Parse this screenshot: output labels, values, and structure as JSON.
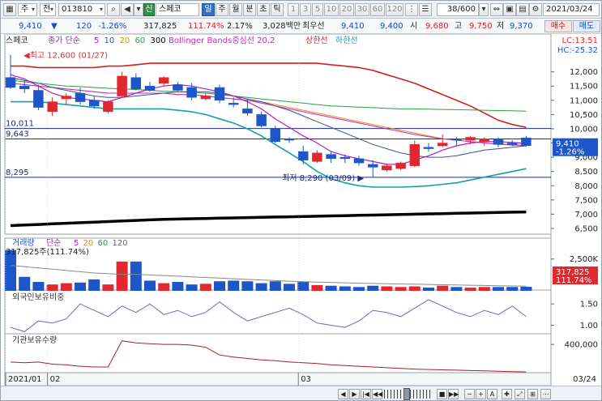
{
  "toolbar": {
    "market": "주",
    "market_type": "전",
    "stock_code": "013810",
    "badge_new": "신",
    "stock_name": "스페코",
    "periods": [
      "일",
      "주",
      "월",
      "분",
      "초",
      "틱"
    ],
    "active_period": "일",
    "intervals": [
      "1",
      "3",
      "5",
      "10",
      "20",
      "30",
      "60",
      "120"
    ],
    "count": "38/600",
    "date": "2021/03/24"
  },
  "quote": {
    "price": "9,410",
    "change": "120",
    "change_pct": "-1.26%",
    "volume": "317,825",
    "vol_ratio": "111.74%",
    "turnover": "2.17%",
    "amount": "3,028백만",
    "pref_label": "최우선",
    "bid1": "9,410",
    "ask1": "9,400",
    "open_label": "시",
    "open": "9,680",
    "high_label": "고",
    "high": "9,750",
    "low_label": "저",
    "low": "9,370",
    "buy_label": "매수",
    "sell_label": "매도"
  },
  "colors": {
    "up": "#e0282e",
    "down": "#1d56c8",
    "ma5": "#b01cc8",
    "ma10": "#3a4f9c",
    "ma20": "#e08a1e",
    "ma60": "#2e9e3e",
    "ma300": "#000000",
    "bb_mid": "#bf2bc3",
    "bb_upper": "#d11f1f",
    "bb_lower": "#14a0a8",
    "foreign": "#7a63c2",
    "inst": "#a81e2a"
  },
  "chart_data": [
    {
      "type": "candlestick",
      "panel": "price",
      "title_name": "스페코",
      "legend": {
        "close_label": "종가 단순",
        "ma_periods": [
          "5",
          "10",
          "20",
          "60",
          "300"
        ],
        "bb_label": "Bollinger Bands중심선 20,2",
        "bb_upper_label": "상한선",
        "bb_lower_label": "하한선"
      },
      "corner_lc": "LC:13.51",
      "corner_hc": "HC:-25.32",
      "ylim": [
        6300,
        13100
      ],
      "y_ticks": [
        12000,
        11500,
        11000,
        10500,
        10000,
        9500,
        9000,
        8500,
        8000,
        7500,
        7000,
        6500
      ],
      "y_tick_labels": [
        "12,000",
        "11,500",
        "11,000",
        "10,500",
        "10,000",
        "9,500",
        "9,000",
        "8,500",
        "8,000",
        "7,500",
        "7,000",
        "6,500"
      ],
      "ref_lines": [
        {
          "value": 10011,
          "label": "10,011"
        },
        {
          "value": 9643,
          "label": "9,643"
        },
        {
          "value": 8295,
          "label": "8,295"
        }
      ],
      "high_annot": {
        "value": 12600,
        "index": 0,
        "label": "최고 12,600 (01/27)"
      },
      "low_annot": {
        "value": 8290,
        "index": 26,
        "label": "최저 8,290 (03/09)"
      },
      "last_price_label": "9,410",
      "last_pct_label": "-1.26%",
      "ohlc": [
        [
          11800,
          12600,
          11400,
          11450
        ],
        [
          11500,
          11700,
          11250,
          11400
        ],
        [
          11350,
          11550,
          10650,
          10750
        ],
        [
          10600,
          11100,
          10450,
          10950
        ],
        [
          11050,
          11250,
          10850,
          11150
        ],
        [
          11250,
          11450,
          10850,
          10950
        ],
        [
          11000,
          11150,
          10700,
          10800
        ],
        [
          10600,
          11000,
          10550,
          10950
        ],
        [
          11150,
          12000,
          11100,
          11850
        ],
        [
          11800,
          11950,
          11350,
          11400
        ],
        [
          11500,
          11650,
          11300,
          11350
        ],
        [
          11600,
          11850,
          11500,
          11800
        ],
        [
          11550,
          11650,
          11300,
          11350
        ],
        [
          11450,
          11600,
          11000,
          11100
        ],
        [
          11050,
          11250,
          11000,
          11150
        ],
        [
          11450,
          11550,
          10900,
          11000
        ],
        [
          10900,
          11100,
          10750,
          10850
        ],
        [
          10700,
          11050,
          10450,
          10550
        ],
        [
          10500,
          10600,
          10050,
          10100
        ],
        [
          10000,
          10100,
          9500,
          9550
        ],
        [
          9650,
          9700,
          9500,
          9600
        ],
        [
          9200,
          9400,
          8750,
          8900
        ],
        [
          8850,
          9250,
          8800,
          9150
        ],
        [
          9100,
          9200,
          8800,
          8950
        ],
        [
          9000,
          9100,
          8800,
          8950
        ],
        [
          8950,
          9050,
          8700,
          8800
        ],
        [
          8750,
          8900,
          8290,
          8650
        ],
        [
          8550,
          8750,
          8500,
          8700
        ],
        [
          8600,
          8850,
          8550,
          8800
        ],
        [
          8700,
          9600,
          8650,
          9450
        ],
        [
          9350,
          9500,
          9200,
          9300
        ],
        [
          9400,
          9800,
          9350,
          9500
        ],
        [
          9650,
          9700,
          9400,
          9600
        ],
        [
          9600,
          9750,
          9450,
          9700
        ],
        [
          9550,
          9700,
          9400,
          9650
        ],
        [
          9650,
          9700,
          9350,
          9450
        ],
        [
          9500,
          9600,
          9400,
          9450
        ],
        [
          9680,
          9750,
          9370,
          9410
        ]
      ],
      "ma5": [
        11900,
        11750,
        11500,
        11250,
        11100,
        11050,
        11000,
        10950,
        11100,
        11250,
        11400,
        11500,
        11550,
        11500,
        11400,
        11300,
        11150,
        10950,
        10700,
        10350,
        10050,
        9750,
        9500,
        9200,
        9050,
        8950,
        8850,
        8750,
        8750,
        8900,
        9050,
        9250,
        9400,
        9500,
        9550,
        9550,
        9520,
        9480
      ],
      "ma10": [
        11800,
        11700,
        11600,
        11450,
        11350,
        11250,
        11150,
        11100,
        11100,
        11150,
        11200,
        11250,
        11300,
        11300,
        11300,
        11250,
        11150,
        11050,
        10950,
        10800,
        10650,
        10450,
        10250,
        10050,
        9850,
        9650,
        9450,
        9300,
        9150,
        9050,
        9000,
        9000,
        9050,
        9150,
        9250,
        9300,
        9350,
        9400
      ],
      "ma20": [
        11600,
        11550,
        11500,
        11450,
        11400,
        11350,
        11300,
        11250,
        11250,
        11250,
        11250,
        11250,
        11200,
        11200,
        11150,
        11100,
        11050,
        11000,
        10950,
        10850,
        10750,
        10650,
        10550,
        10450,
        10350,
        10250,
        10150,
        10050,
        9950,
        9850,
        9750,
        9650,
        9600,
        9550,
        9500,
        9450,
        9420,
        9400
      ],
      "ma60": [
        11700,
        11650,
        11600,
        11550,
        11500,
        11480,
        11450,
        11420,
        11400,
        11380,
        11350,
        11320,
        11300,
        11280,
        11250,
        11200,
        11150,
        11100,
        11050,
        11000,
        10950,
        10900,
        10850,
        10800,
        10780,
        10760,
        10740,
        10720,
        10700,
        10700,
        10690,
        10680,
        10670,
        10660,
        10650,
        10640,
        10630,
        10620
      ],
      "ma300": [
        6600,
        6620,
        6640,
        6660,
        6680,
        6700,
        6720,
        6740,
        6760,
        6780,
        6800,
        6820,
        6830,
        6840,
        6850,
        6860,
        6870,
        6880,
        6890,
        6900,
        6910,
        6920,
        6930,
        6940,
        6950,
        6960,
        6970,
        6980,
        6990,
        7000,
        7010,
        7020,
        7030,
        7040,
        7050,
        7060,
        7070,
        7080
      ],
      "bb_mid": [
        11600,
        11550,
        11500,
        11450,
        11400,
        11350,
        11300,
        11250,
        11250,
        11250,
        11250,
        11250,
        11200,
        11200,
        11150,
        11100,
        11050,
        11000,
        10900,
        10800,
        10700,
        10600,
        10500,
        10400,
        10300,
        10200,
        10100,
        10000,
        9900,
        9800,
        9720,
        9650,
        9600,
        9550,
        9500,
        9470,
        9440,
        9410
      ],
      "bb_upper": [
        12200,
        12200,
        12150,
        12150,
        12150,
        12150,
        12150,
        12200,
        12200,
        12250,
        12300,
        12300,
        12300,
        12300,
        12300,
        12300,
        12300,
        12300,
        12300,
        12300,
        12300,
        12300,
        12300,
        12250,
        12200,
        12150,
        12050,
        11900,
        11750,
        11600,
        11400,
        11200,
        11000,
        10800,
        10550,
        10300,
        10150,
        10050
      ],
      "bb_lower": [
        10950,
        10950,
        10950,
        10900,
        10850,
        10800,
        10750,
        10700,
        10700,
        10700,
        10700,
        10700,
        10650,
        10600,
        10500,
        10350,
        10200,
        10000,
        9750,
        9450,
        9150,
        8850,
        8500,
        8250,
        8100,
        8000,
        7950,
        7950,
        7950,
        7970,
        8000,
        8050,
        8100,
        8200,
        8300,
        8400,
        8500,
        8600
      ]
    },
    {
      "type": "bar",
      "panel": "volume",
      "title_name": "거래량",
      "legend_label": "단순",
      "ma_periods": [
        "5",
        "20",
        "60",
        "120"
      ],
      "top_label": "317,825주(111.74%)",
      "right_value": "317,825",
      "right_pct": "111.74%",
      "y_tick_label": "2,500K",
      "ylim": [
        0,
        3500000
      ],
      "values": [
        3200000,
        1100000,
        700000,
        500000,
        600000,
        650000,
        900000,
        500000,
        2300000,
        2300000,
        800000,
        600000,
        700000,
        500000,
        550000,
        750000,
        800000,
        750000,
        600000,
        750000,
        550000,
        700000,
        450000,
        400000,
        350000,
        300000,
        400000,
        350000,
        300000,
        350000,
        250000,
        400000,
        300000,
        250000,
        300000,
        300000,
        300000,
        320000
      ],
      "ma": [
        2000000,
        1900000,
        1800000,
        1700000,
        1600000,
        1500000,
        1400000,
        1350000,
        1300000,
        1300000,
        1250000,
        1200000,
        1150000,
        1100000,
        1050000,
        1000000,
        950000,
        900000,
        850000,
        800000,
        760000,
        720000,
        690000,
        660000,
        630000,
        600000,
        580000,
        560000,
        540000,
        520000,
        500000,
        480000,
        460000,
        440000,
        420000,
        400000,
        380000,
        360000
      ]
    },
    {
      "type": "line",
      "panel": "foreign",
      "title_name": "외국인보유비중",
      "y_ticks": [
        1.5,
        1.0
      ],
      "y_tick_labels": [
        "1.50",
        "1.00"
      ],
      "ylim": [
        0.8,
        1.75
      ],
      "values": [
        0.95,
        0.85,
        1.1,
        1.05,
        1.15,
        1.5,
        1.35,
        1.2,
        1.45,
        1.3,
        1.5,
        1.25,
        1.35,
        1.2,
        1.3,
        1.55,
        1.3,
        1.1,
        1.2,
        1.3,
        1.4,
        1.25,
        1.05,
        1.0,
        0.95,
        1.1,
        1.35,
        1.3,
        1.2,
        1.4,
        1.6,
        1.45,
        1.3,
        1.2,
        1.35,
        1.25,
        1.45,
        1.2
      ]
    },
    {
      "type": "line",
      "panel": "institution",
      "title_name": "기관보유수량",
      "y_ticks": [
        400000
      ],
      "y_tick_labels": [
        "400,000"
      ],
      "ylim": [
        0,
        550000
      ],
      "values": [
        150000,
        140000,
        150000,
        120000,
        110000,
        90000,
        80000,
        80000,
        450000,
        420000,
        410000,
        400000,
        400000,
        390000,
        360000,
        250000,
        220000,
        200000,
        180000,
        170000,
        150000,
        140000,
        130000,
        110000,
        100000,
        90000,
        80000,
        70000,
        60000,
        50000,
        45000,
        40000,
        35000,
        30000,
        25000,
        20000,
        15000,
        10000
      ]
    }
  ],
  "x_axis": {
    "labels": [
      {
        "text": "2021/01",
        "index": 0
      },
      {
        "text": "02",
        "index": 3
      },
      {
        "text": "03",
        "index": 21
      }
    ],
    "end_label": "03/24"
  },
  "bottom_nav": [
    "◀",
    "▶",
    "|◀",
    "◀◀",
    "■",
    "▶▶",
    "−",
    "+",
    "A"
  ]
}
